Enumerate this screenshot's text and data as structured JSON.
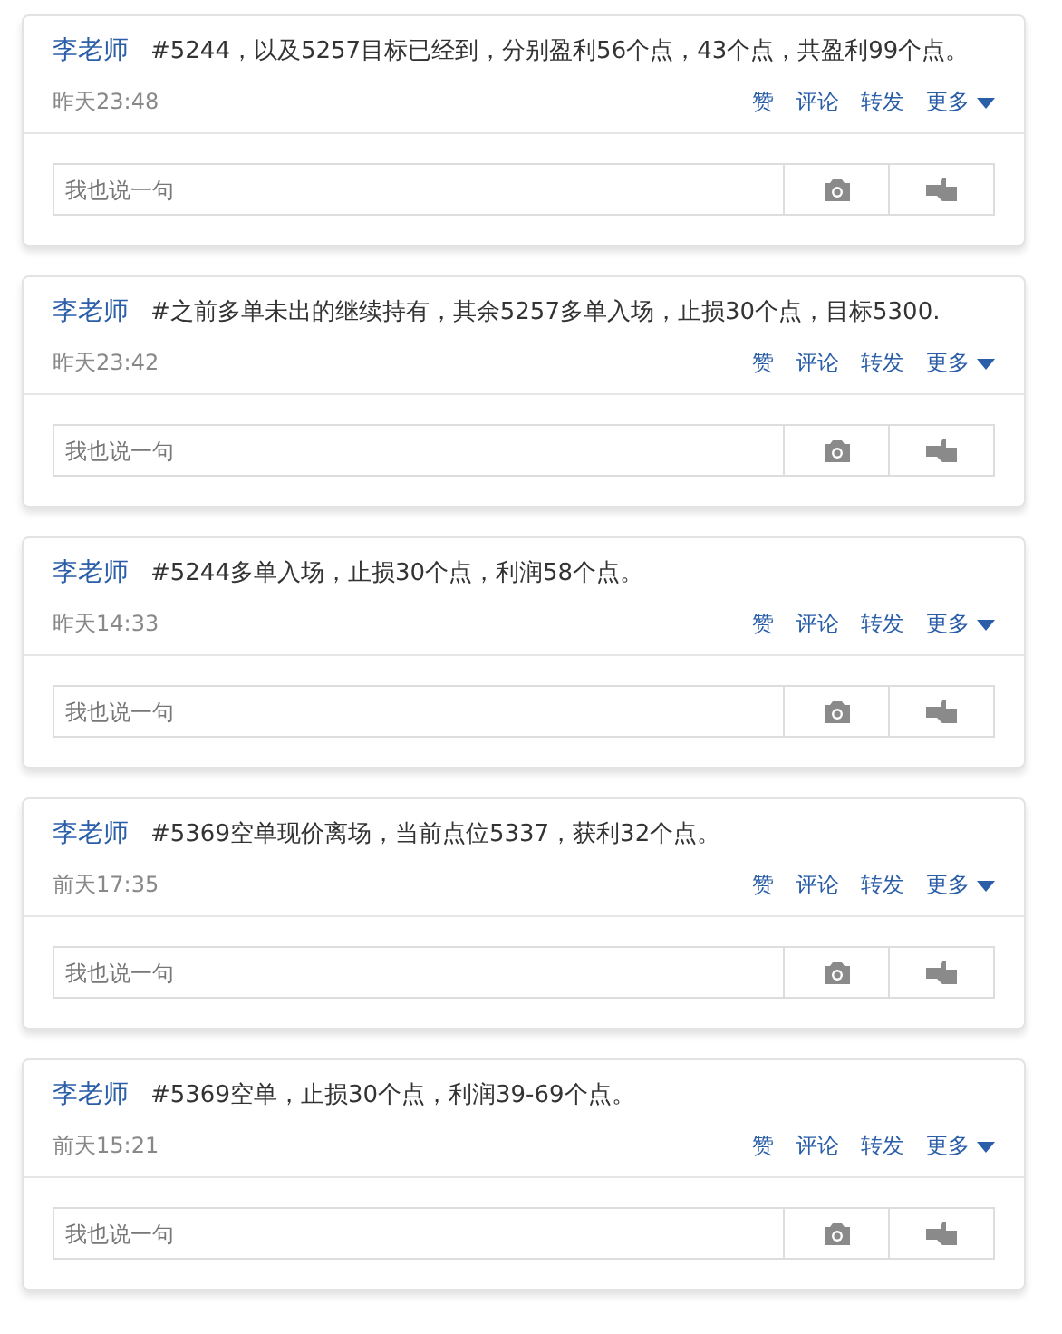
{
  "posts": [
    {
      "author": "李老师",
      "text": "#5244，以及5257目标已经到，分别盈利56个点，43个点，共盈利99个点。",
      "time": "昨天23:48",
      "actions": [
        "赞",
        "评论",
        "转发",
        "更多"
      ],
      "comment_placeholder": "我也说一句"
    },
    {
      "author": "李老师",
      "text": "#之前多单未出的继续持有，其余5257多单入场，止损30个点，目标5300.",
      "time": "昨天23:42",
      "actions": [
        "赞",
        "评论",
        "转发",
        "更多"
      ],
      "comment_placeholder": "我也说一句"
    },
    {
      "author": "李老师",
      "text": "#5244多单入场，止损30个点，利润58个点。",
      "time": "昨天14:33",
      "actions": [
        "赞",
        "评论",
        "转发",
        "更多"
      ],
      "comment_placeholder": "我也说一句"
    },
    {
      "author": "李老师",
      "text": "#5369空单现价离场，当前点位5337，获利32个点。",
      "time": "前天17:35",
      "actions": [
        "赞",
        "评论",
        "转发",
        "更多"
      ],
      "comment_placeholder": "我也说一句"
    },
    {
      "author": "李老师",
      "text": "#5369空单，止损30个点，利润39-69个点。",
      "time": "前天15:21",
      "actions": [
        "赞",
        "评论",
        "转发",
        "更多"
      ],
      "comment_placeholder": "我也说一句"
    }
  ]
}
